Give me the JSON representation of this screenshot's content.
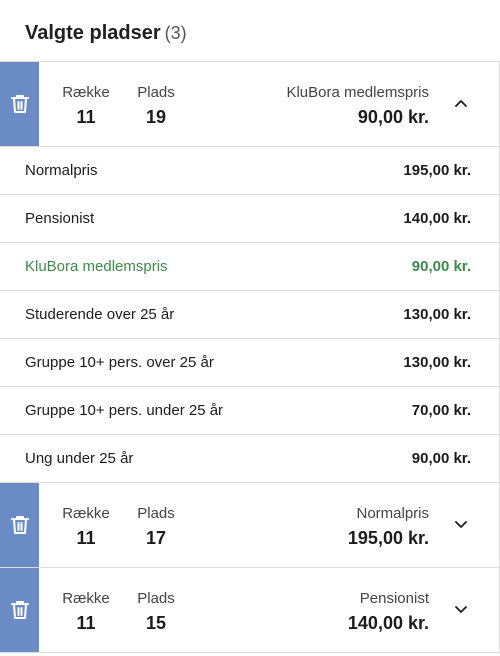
{
  "header": {
    "title": "Valgte pladser",
    "count": "(3)"
  },
  "labels": {
    "row": "Række",
    "seat": "Plads"
  },
  "seats": [
    {
      "row": "11",
      "seat": "19",
      "ticket_type": "KluBora medlemspris",
      "price": "90,00 kr.",
      "expanded": true,
      "options": [
        {
          "name": "Normalpris",
          "price": "195,00 kr."
        },
        {
          "name": "Pensionist",
          "price": "140,00 kr."
        },
        {
          "name": "KluBora medlemspris",
          "price": "90,00 kr.",
          "selected": true
        },
        {
          "name": "Studerende over 25 år",
          "price": "130,00 kr."
        },
        {
          "name": "Gruppe 10+ pers. over 25 år",
          "price": "130,00 kr."
        },
        {
          "name": "Gruppe 10+ pers. under 25 år",
          "price": "70,00 kr."
        },
        {
          "name": "Ung under 25 år",
          "price": "90,00 kr."
        }
      ]
    },
    {
      "row": "11",
      "seat": "17",
      "ticket_type": "Normalpris",
      "price": "195,00 kr.",
      "expanded": false
    },
    {
      "row": "11",
      "seat": "15",
      "ticket_type": "Pensionist",
      "price": "140,00 kr.",
      "expanded": false
    }
  ],
  "colors": {
    "trash_bg": "#6b8bc4",
    "selected_text": "#3f8a4d",
    "divider": "#dcdcdc"
  },
  "icons": {
    "delete": "trash-icon",
    "expand": "chevron-down-icon",
    "collapse": "chevron-up-icon"
  }
}
